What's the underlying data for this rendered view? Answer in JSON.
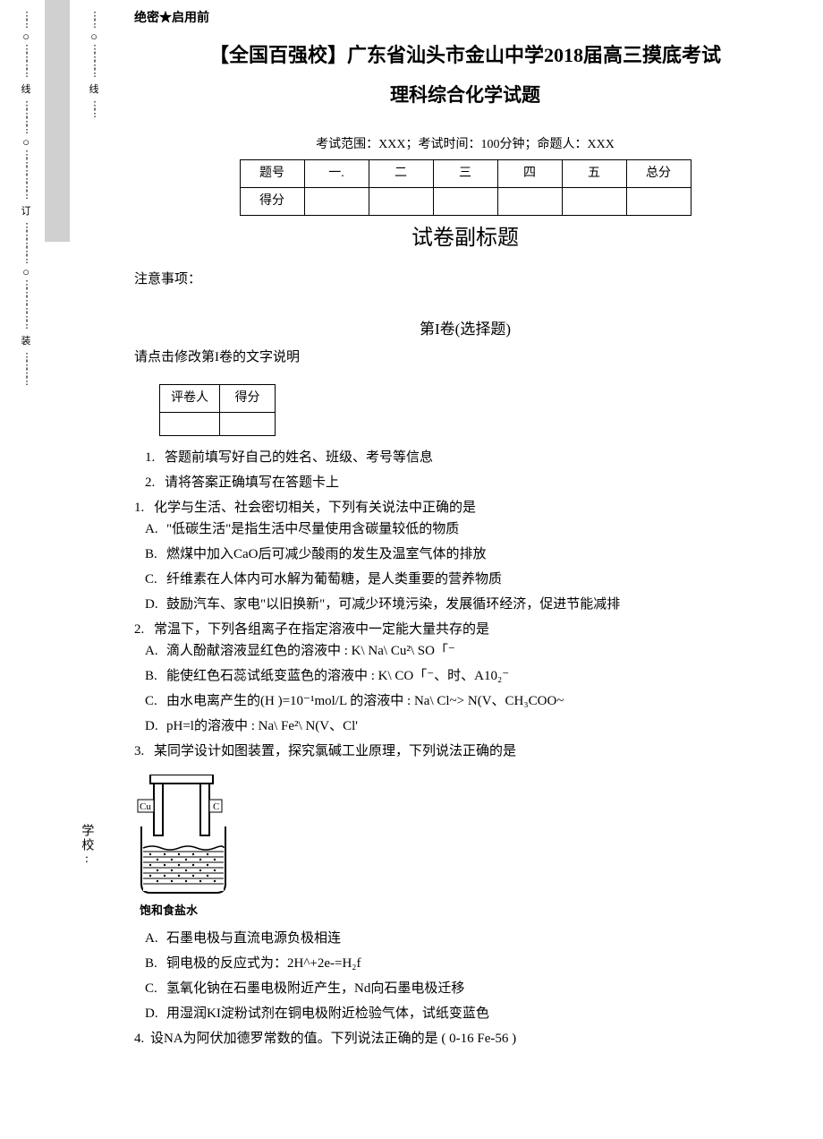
{
  "header": {
    "confidential": "绝密★启用前",
    "title_line1": "【全国百强校】广东省汕头市金山中学2018届高三摸底考试",
    "title_line2": "理科综合化学试题",
    "exam_info": "考试范围：XXX；考试时间：100分钟；命题人：XXX"
  },
  "score_table": {
    "headers": [
      "题号",
      "一.",
      "二",
      "三",
      "四",
      "五",
      "总分"
    ],
    "row_label": "得分"
  },
  "subtitle": "试卷副标题",
  "notice_label": "注意事项：",
  "section1": {
    "title": "第I卷(选择题)",
    "note": "请点击修改第I卷的文字说明"
  },
  "small_table": {
    "h1": "评卷人",
    "h2": "得分"
  },
  "instructions": [
    "答题前填写好自己的姓名、班级、考号等信息",
    "请将答案正确填写在答题卡上"
  ],
  "questions": [
    {
      "num": "1.",
      "stem": "化学与生活、社会密切相关，下列有关说法中正确的是",
      "options": [
        "\"低碳生活\"是指生活中尽量使用含碳量较低的物质",
        "燃煤中加入CaO后可减少酸雨的发生及温室气体的排放",
        "纤维素在人体内可水解为葡萄糖，是人类重要的营养物质",
        "鼓励汽车、家电\"以旧换新\"，可减少环境污染，发展循环经济，促进节能减排"
      ]
    },
    {
      "num": "2.",
      "stem": "常温下，下列各组离子在指定溶液中一定能大量共存的是",
      "options": [
        "滴人酚献溶液显红色的溶液中 : K\\ Na\\ Cu²\\ SO「⁻",
        "能使红色石蕊试纸变蓝色的溶液中 : K\\ CO「⁻、时、A10₂⁻",
        "由水电离产生的(H )=10⁻¹mol/L 的溶液中 : Na\\ Cl~> N(V、CH₃COO~",
        "pH=l的溶液中 : Na\\ Fe²\\ N(V、Cl'"
      ]
    },
    {
      "num": "3.",
      "stem": "某同学设计如图装置，探究氯碱工业原理，下列说法正确的是",
      "figure": {
        "left_label": "Cu",
        "right_label": "C",
        "caption": "饱和食盐水"
      },
      "options": [
        "石墨电极与直流电源负极相连",
        "铜电极的反应式为：2H^+2e-=H₂f",
        "氢氧化钠在石墨电极附近产生，Nd向石墨电极迁移",
        "用湿润KI淀粉试剂在铜电极附近检验气体，试纸变蓝色"
      ]
    },
    {
      "num": "4.",
      "stem": "设NA为阿伏加德罗常数的值。下列说法正确的是 ( 0-16 Fe-56 )"
    }
  ],
  "option_labels": [
    "A.",
    "B.",
    "C.",
    "D."
  ],
  "margin": {
    "leftchar": "线",
    "rightchar": "线",
    "midleft": "订",
    "midright": "装",
    "school": "学校:"
  }
}
